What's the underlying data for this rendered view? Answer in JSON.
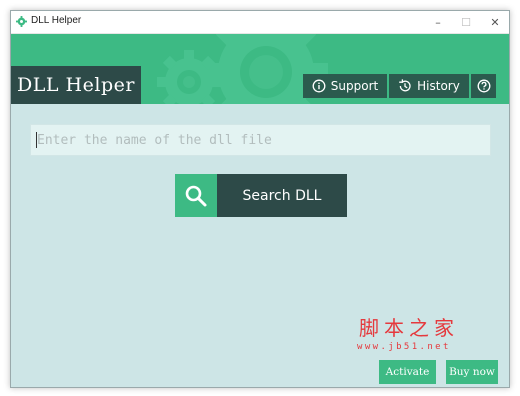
{
  "window": {
    "title": "DLL Helper",
    "controls": {
      "minimize": "–",
      "maximize": "☐",
      "close": "✕"
    }
  },
  "header": {
    "brand": "DLL Helper",
    "buttons": [
      {
        "label": "Support",
        "icon": "info-icon"
      },
      {
        "label": "History",
        "icon": "history-icon"
      },
      {
        "label": "",
        "icon": "help-icon"
      }
    ]
  },
  "search": {
    "placeholder": "Enter the name of the dll file",
    "value": "",
    "button_label": "Search DLL",
    "button_icon": "search-icon"
  },
  "watermark": {
    "brand": "脚本之家",
    "url": "www.jb51.net"
  },
  "footer": {
    "activate_label": "Activate",
    "buy_now_label": "Buy now"
  },
  "colors": {
    "accent_green": "#3dba84",
    "dark_teal": "#2d4a48",
    "button_dark_green": "#2b5b4e",
    "background": "#cde5e6",
    "watermark_red": "#e5393d"
  }
}
